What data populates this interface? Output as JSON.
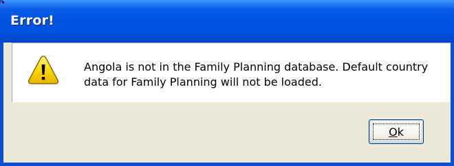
{
  "window": {
    "title": "Error!"
  },
  "dialog": {
    "icon": "warning-triangle-icon",
    "message": "Angola is not in the Family Planning database. Default country data for Family Planning will not be loaded."
  },
  "buttons": {
    "ok_mnemonic": "O",
    "ok_rest": "k"
  },
  "colors": {
    "titlebar": "#0054e3",
    "dialog_bg": "#ece9d8",
    "icon_fill": "#ffd800"
  }
}
